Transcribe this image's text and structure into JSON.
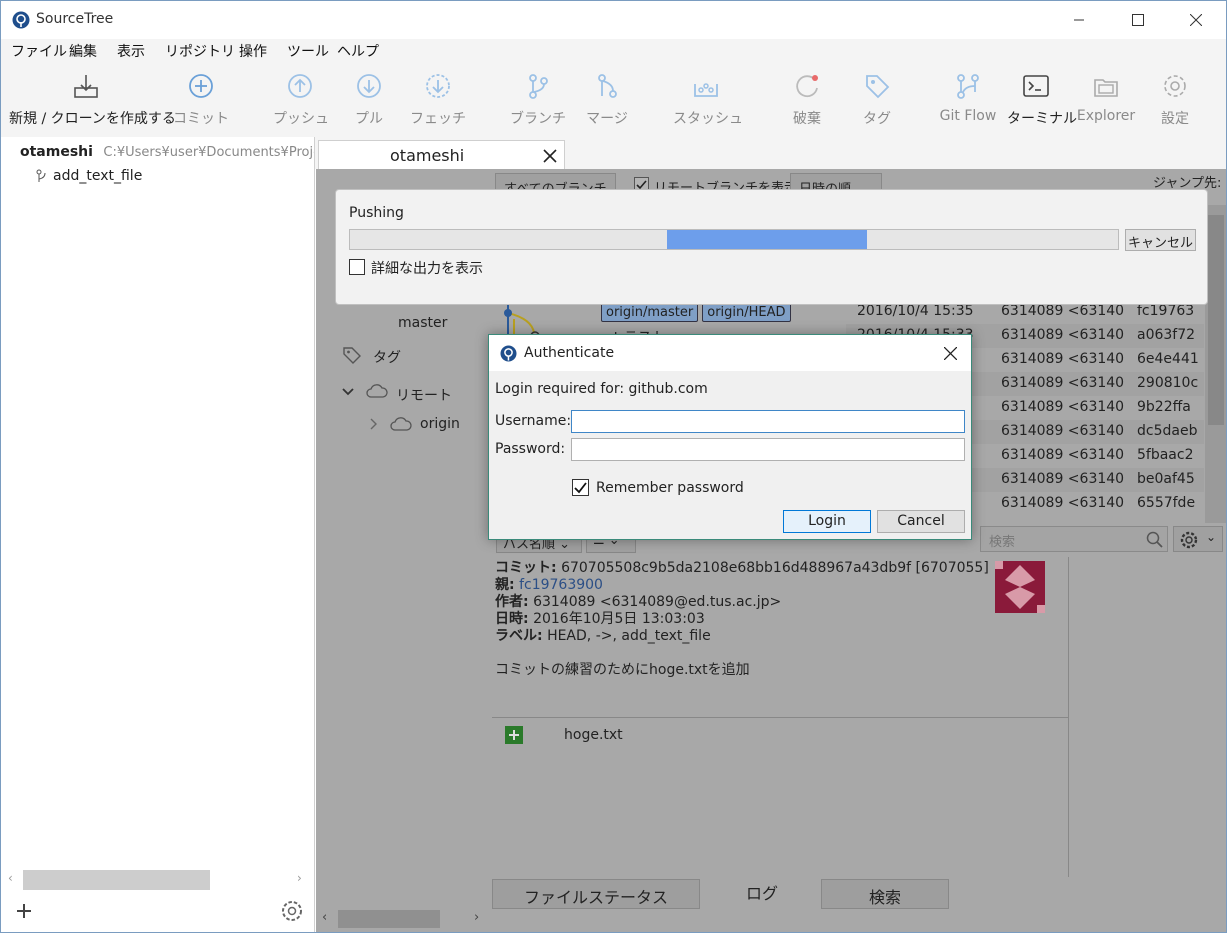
{
  "app": {
    "title": "SourceTree"
  },
  "menu": [
    "ファイル",
    "編集",
    "表示",
    "リポジトリ",
    "操作",
    "ツール",
    "ヘルプ"
  ],
  "toolbar": {
    "clone": "新規 / クローンを作成する",
    "commit": "コミット",
    "push": "プッシュ",
    "pull": "プル",
    "fetch": "フェッチ",
    "branch": "ブランチ",
    "merge": "マージ",
    "stash": "スタッシュ",
    "discard": "破棄",
    "tag": "タグ",
    "gitflow": "Git Flow",
    "terminal": "ターミナル",
    "explorer": "Explorer",
    "settings": "設定"
  },
  "sidebar": {
    "repo_name": "otameshi",
    "repo_path": "C:¥Users¥user¥Documents¥Projec",
    "branch": "add_text_file"
  },
  "tab": {
    "label": "otameshi"
  },
  "filters": {
    "branches": "すべてのブランチ",
    "show_remote": "リモートブランチを表示",
    "sort": "日時の順",
    "jump": "ジャンプ先:"
  },
  "nav": {
    "master": "master",
    "tags": "タグ",
    "remotes": "リモート",
    "origin": "origin"
  },
  "commits": [
    {
      "desc_labels": [
        "origin/master",
        "origin/HEAD"
      ],
      "date": "2016/10/4  15:35",
      "author": "6314089 <6314089",
      "hash": "fc19763"
    },
    {
      "desc": "rt テスト",
      "date": "2016/10/4  15:33",
      "author": "6314089 <6314089",
      "hash": "a063f72"
    },
    {
      "desc": "",
      "date": "",
      "author": "6314089 <6314089",
      "hash": "6e4e441"
    },
    {
      "desc": "",
      "date": "",
      "author": "6314089 <6314089",
      "hash": "290810c"
    },
    {
      "desc": "",
      "date": "",
      "author": "6314089 <6314089",
      "hash": "9b22ffa"
    },
    {
      "desc": "",
      "date": "",
      "author": "6314089 <6314089",
      "hash": "dc5daeb"
    },
    {
      "desc": "",
      "date": "",
      "author": "6314089 <6314089",
      "hash": "5fbaac2"
    },
    {
      "desc": "",
      "date": "",
      "author": "6314089 <6314089",
      "hash": "be0af45"
    },
    {
      "desc": "",
      "date": "",
      "author": "6314089 <6314089",
      "hash": "6557fde"
    }
  ],
  "files_toolbar": {
    "sort": "パス名順",
    "search_placeholder": "検索"
  },
  "details": {
    "commit_label": "コミット:",
    "commit": "670705508c9b5da2108e68bb16d488967a43db9f [6707055]",
    "parent_label": "親:",
    "parent": "fc19763900",
    "author_label": "作者:",
    "author": "6314089 <6314089@ed.tus.ac.jp>",
    "date_label": "日時:",
    "date": "2016年10月5日 13:03:03",
    "labels_label": "ラベル:",
    "labels": "HEAD, ->, add_text_file",
    "message": "コミットの練習のためにhoge.txtを追加"
  },
  "files": [
    {
      "name": "hoge.txt",
      "status": "added"
    }
  ],
  "bottom_tabs": [
    "ファイルステータス",
    "ログ",
    "検索"
  ],
  "pushing": {
    "title": "Pushing",
    "progress": 0.26,
    "cancel": "キャンセル",
    "verbose": "詳細な出力を表示"
  },
  "auth": {
    "title": "Authenticate",
    "prompt": "Login required for: github.com",
    "username_label": "Username:",
    "password_label": "Password:",
    "username": "",
    "password": "",
    "remember": "Remember password",
    "remember_checked": true,
    "login": "Login",
    "cancel": "Cancel"
  }
}
